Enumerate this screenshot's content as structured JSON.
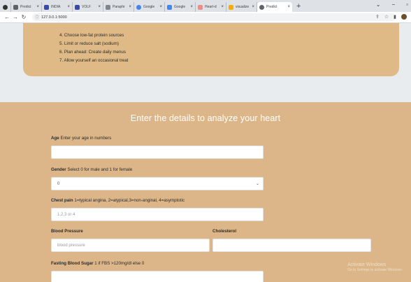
{
  "browser": {
    "tabs": [
      {
        "label": "",
        "color": "#5f6368"
      },
      {
        "label": "Predict",
        "color": "#5f6368"
      },
      {
        "label": "INDIA",
        "color": "#3949ab"
      },
      {
        "label": "VOLF",
        "color": "#3949ab"
      },
      {
        "label": "Paraphr",
        "color": "#80868b"
      },
      {
        "label": "Google",
        "color": "#4285f4"
      },
      {
        "label": "Google",
        "color": "#4285f4"
      },
      {
        "label": "Heart-d",
        "color": "#f28b82"
      },
      {
        "label": "visualize",
        "color": "#f9ab00"
      },
      {
        "label": "Predict",
        "color": "#5f6368"
      }
    ],
    "url": "127.0.0.1:5000"
  },
  "tips": [
    "4. Choose low-fat protein sources",
    "5. Limit or reduce salt (sodium)",
    "6. Plan ahead: Create daily menus",
    "7. Allow yourself an occasional treat"
  ],
  "form": {
    "title": "Enter the details to analyze your heart",
    "age": {
      "label": "Age",
      "hint": "Enter your age in numbers",
      "value": ""
    },
    "gender": {
      "label": "Gender",
      "hint": "Select 0 for male and 1 for female",
      "selected": "0"
    },
    "chest_pain": {
      "label": "Chest pain",
      "hint": "1=typical angina, 2=atypical,3=non-anginal, 4=asymptotic",
      "placeholder": "1,2,3 or 4"
    },
    "blood_pressure": {
      "label": "Blood Pressure",
      "placeholder": "blood pressure"
    },
    "cholesterol": {
      "label": "Cholesterol",
      "value": ""
    },
    "fbs": {
      "label": "Fasting Blood Sugar",
      "hint": "1 if FBS >120mg/dl else 0",
      "value": ""
    }
  },
  "watermark": {
    "line1": "Activate Windows",
    "line2": "Go to Settings to activate Windows."
  }
}
